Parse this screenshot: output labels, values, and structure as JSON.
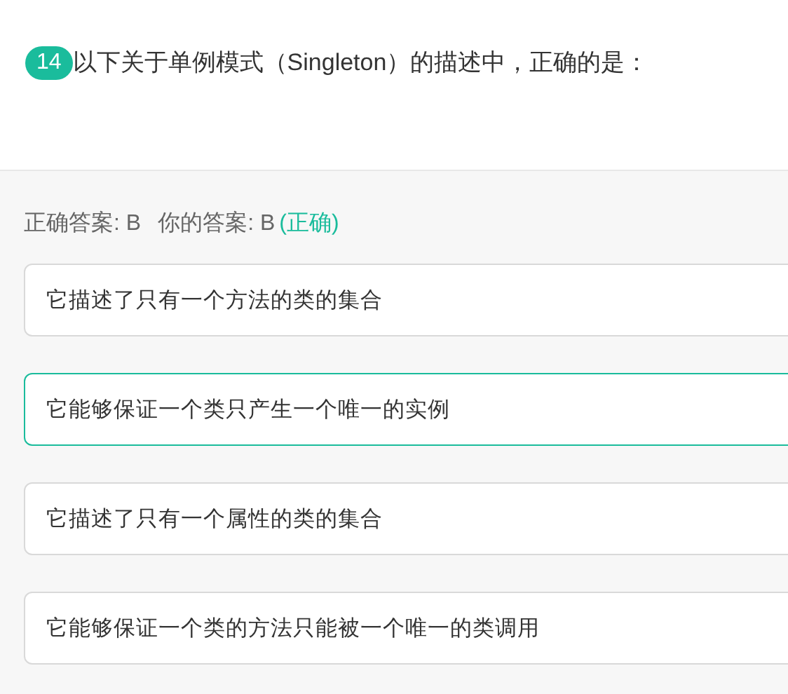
{
  "question": {
    "number": "14",
    "text": "以下关于单例模式（Singleton）的描述中，正确的是："
  },
  "result": {
    "correct_answer": "正确答案: B",
    "your_answer": "你的答案: B",
    "verdict": "(正确)"
  },
  "options": [
    {
      "text": "它描述了只有一个方法的类的集合",
      "selected": false
    },
    {
      "text": "它能够保证一个类只产生一个唯一的实例",
      "selected": true
    },
    {
      "text": "它描述了只有一个属性的类的集合",
      "selected": false
    },
    {
      "text": "它能够保证一个类的方法只能被一个唯一的类调用",
      "selected": false
    }
  ]
}
